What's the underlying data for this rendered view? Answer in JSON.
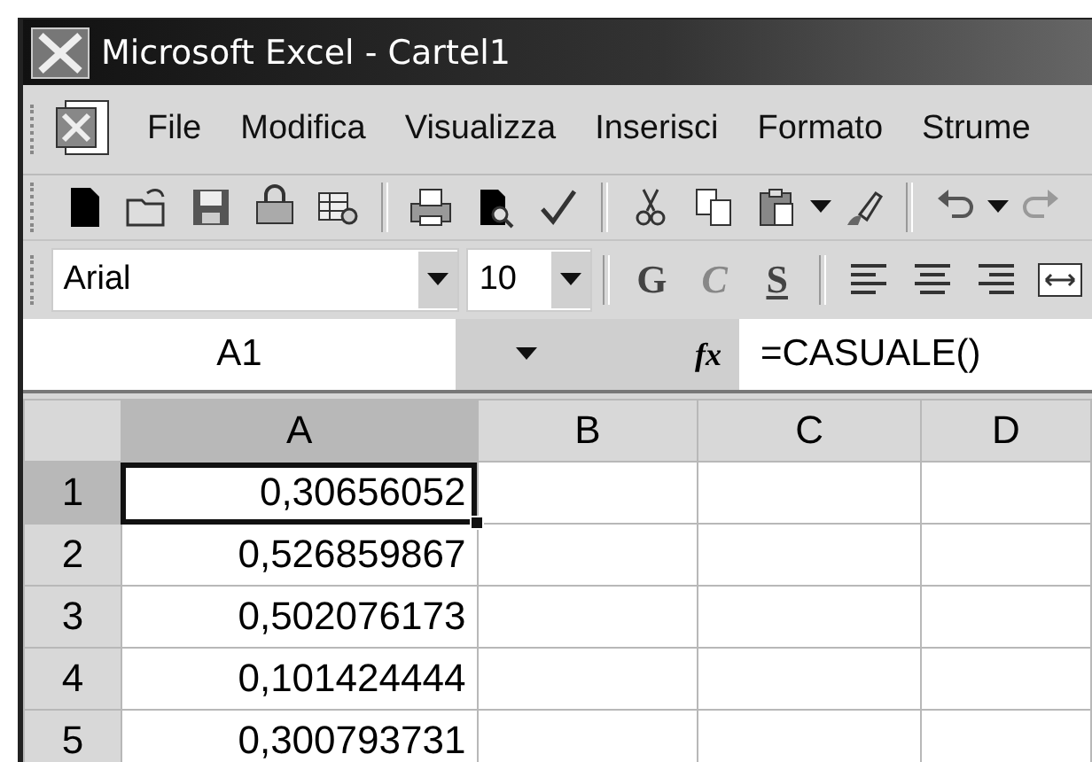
{
  "window": {
    "title": "Microsoft Excel - Cartel1"
  },
  "menu": [
    {
      "label": "File"
    },
    {
      "label": "Modifica"
    },
    {
      "label": "Visualizza"
    },
    {
      "label": "Inserisci"
    },
    {
      "label": "Formato"
    },
    {
      "label": "Strume"
    }
  ],
  "format_toolbar": {
    "font": "Arial",
    "size": "10",
    "bold": "G",
    "italic": "C",
    "underline": "S"
  },
  "formula_bar": {
    "name_box": "A1",
    "function_label": "fx",
    "formula": "=CASUALE()"
  },
  "sheet": {
    "columns": [
      {
        "label": "A",
        "selected": true
      },
      {
        "label": "B",
        "selected": false
      },
      {
        "label": "C",
        "selected": false
      },
      {
        "label": "D",
        "selected": false
      }
    ],
    "rows": [
      {
        "label": "1",
        "selected": true,
        "cells": [
          {
            "value": "0,30656052",
            "selected": true
          }
        ]
      },
      {
        "label": "2",
        "selected": false,
        "cells": [
          {
            "value": "0,526859867",
            "selected": false
          }
        ]
      },
      {
        "label": "3",
        "selected": false,
        "cells": [
          {
            "value": "0,502076173",
            "selected": false
          }
        ]
      },
      {
        "label": "4",
        "selected": false,
        "cells": [
          {
            "value": "0,101424444",
            "selected": false
          }
        ]
      },
      {
        "label": "5",
        "selected": false,
        "cells": [
          {
            "value": "0,300793731",
            "selected": false
          }
        ]
      }
    ]
  }
}
